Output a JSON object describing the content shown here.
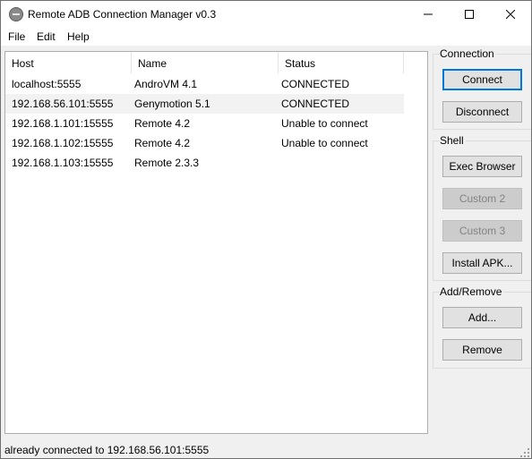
{
  "window": {
    "title": "Remote ADB Connection Manager v0.3",
    "app_icon": "adb-circle-icon"
  },
  "menu": {
    "items": [
      "File",
      "Edit",
      "Help"
    ]
  },
  "list": {
    "columns": [
      "Host",
      "Name",
      "Status"
    ],
    "rows": [
      {
        "host": "localhost:5555",
        "name": "AndroVM 4.1",
        "status": "CONNECTED",
        "selected": false
      },
      {
        "host": "192.168.56.101:5555",
        "name": "Genymotion 5.1",
        "status": "CONNECTED",
        "selected": true
      },
      {
        "host": "192.168.1.101:15555",
        "name": "Remote 4.2",
        "status": "Unable to connect",
        "selected": false
      },
      {
        "host": "192.168.1.102:15555",
        "name": "Remote 4.2",
        "status": "Unable to connect",
        "selected": false
      },
      {
        "host": "192.168.1.103:15555",
        "name": "Remote 2.3.3",
        "status": "",
        "selected": false
      }
    ]
  },
  "groups": {
    "connection": {
      "title": "Connection",
      "connect_label": "Connect",
      "disconnect_label": "Disconnect"
    },
    "shell": {
      "title": "Shell",
      "exec_browser_label": "Exec Browser",
      "custom2_label": "Custom 2",
      "custom3_label": "Custom 3",
      "install_apk_label": "Install APK..."
    },
    "add_remove": {
      "title": "Add/Remove",
      "add_label": "Add...",
      "remove_label": "Remove"
    }
  },
  "status_bar": {
    "text": "already connected to 192.168.56.101:5555"
  },
  "colors": {
    "accent": "#0078d7",
    "selected_row": "#f2f2f2",
    "button_face": "#e1e1e1",
    "disabled_text": "#838383"
  }
}
